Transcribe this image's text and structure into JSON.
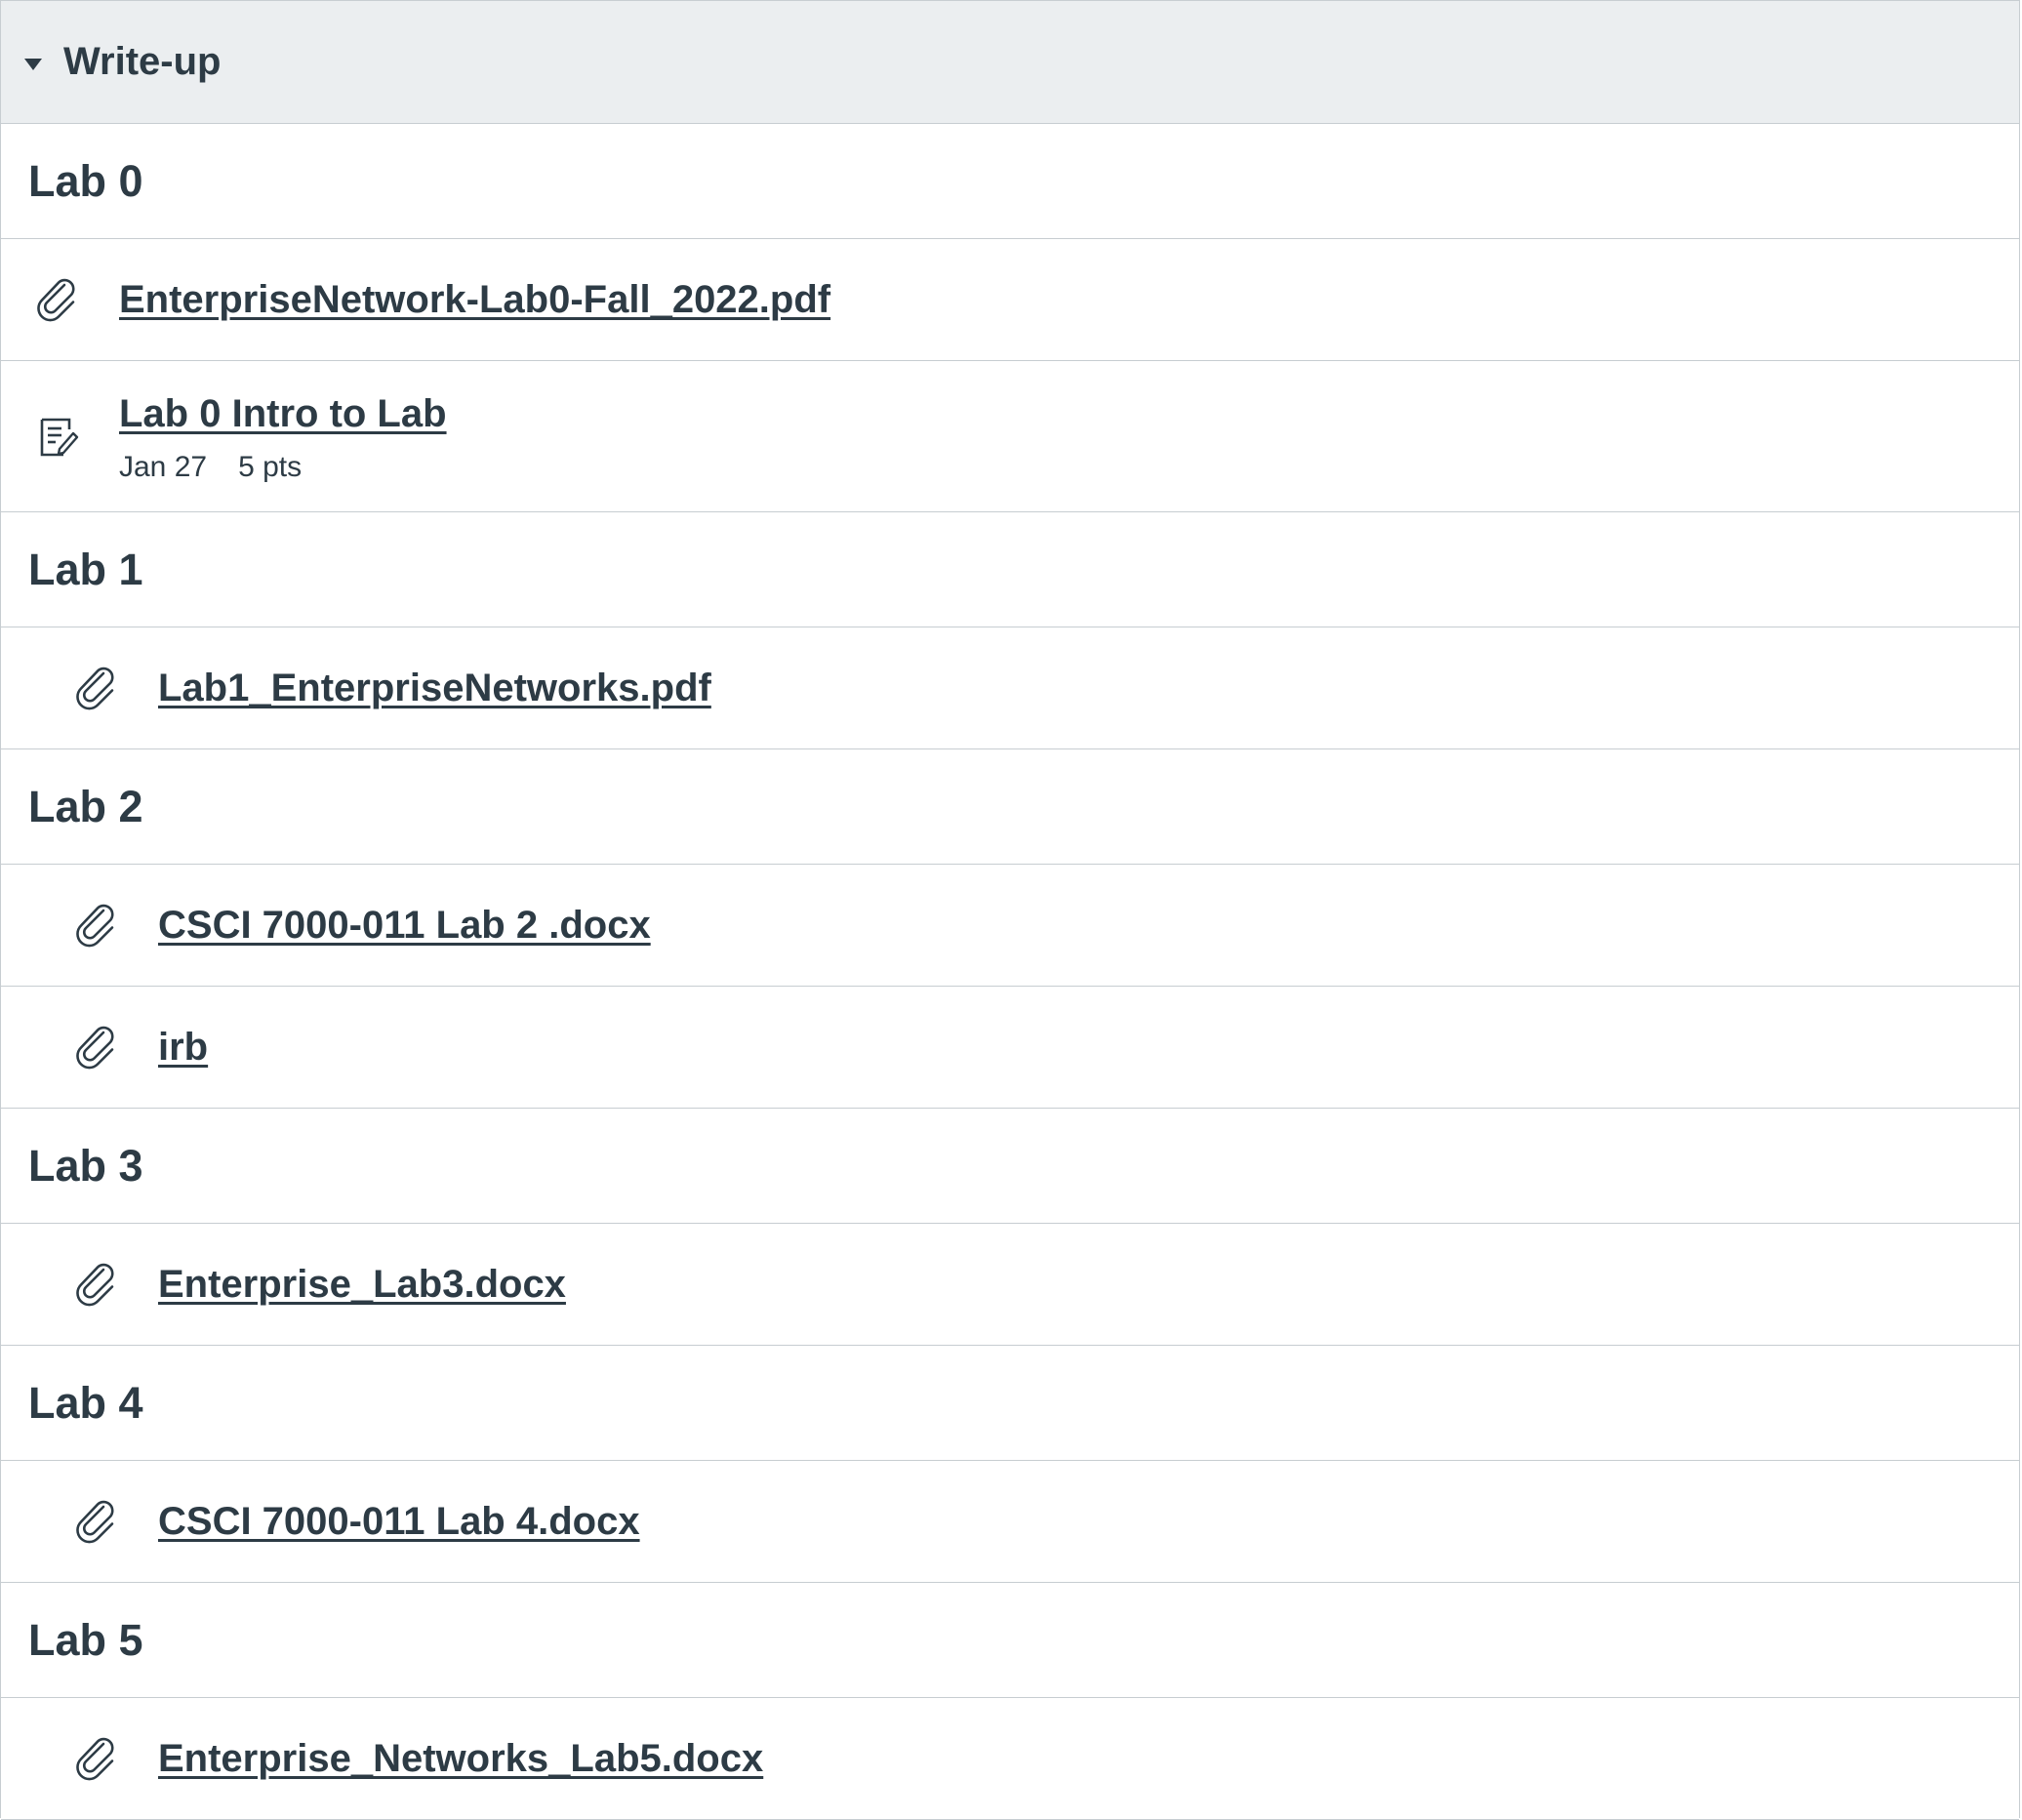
{
  "module": {
    "title": "Write-up",
    "rows": [
      {
        "kind": "header",
        "label": "Lab 0"
      },
      {
        "kind": "file",
        "label": "EnterpriseNetwork-Lab0-Fall_2022.pdf",
        "icon": "paperclip-icon"
      },
      {
        "kind": "assignment",
        "label": "Lab 0 Intro to Lab",
        "date": "Jan 27",
        "points": "5 pts",
        "icon": "assignment-icon"
      },
      {
        "kind": "header",
        "label": "Lab 1"
      },
      {
        "kind": "file",
        "label": "Lab1_EnterpriseNetworks.pdf",
        "icon": "paperclip-icon"
      },
      {
        "kind": "header",
        "label": "Lab 2"
      },
      {
        "kind": "file",
        "label": "CSCI 7000-011 Lab 2 .docx",
        "icon": "paperclip-icon"
      },
      {
        "kind": "file",
        "label": "irb",
        "icon": "paperclip-icon"
      },
      {
        "kind": "header",
        "label": "Lab 3"
      },
      {
        "kind": "file",
        "label": "Enterprise_Lab3.docx",
        "icon": "paperclip-icon"
      },
      {
        "kind": "header",
        "label": "Lab 4"
      },
      {
        "kind": "file",
        "label": "CSCI 7000-011 Lab 4.docx",
        "icon": "paperclip-icon"
      },
      {
        "kind": "header",
        "label": "Lab 5"
      },
      {
        "kind": "file",
        "label": "Enterprise_Networks_Lab5.docx",
        "icon": "paperclip-icon"
      }
    ]
  },
  "colors": {
    "text": "#2d3b45",
    "header_bg": "#ebeef0",
    "border": "#c7cdd1"
  }
}
